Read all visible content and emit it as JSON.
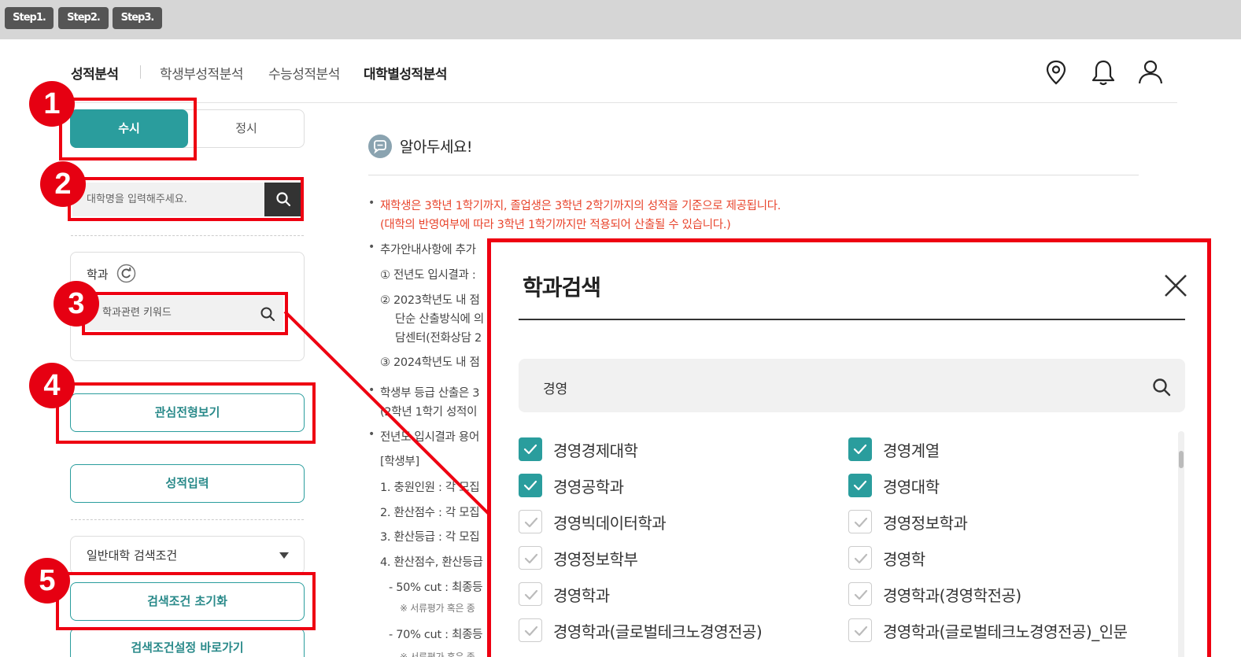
{
  "steps": [
    "Step1.",
    "Step2.",
    "Step3."
  ],
  "nav": {
    "brand": "성적분석",
    "items": [
      "학생부성적분석",
      "수능성적분석",
      "대학별성적분석"
    ],
    "active": "대학별성적분석",
    "icons": [
      "location-icon",
      "bell-icon",
      "user-icon"
    ]
  },
  "left": {
    "tabs": [
      "수시",
      "정시"
    ],
    "selected_tab": "수시",
    "univ_search_placeholder": "대학명을 입력해주세요.",
    "dept_label": "학과",
    "dept_search_placeholder": "학과관련 키워드",
    "interest_button": "관심전형보기",
    "score_button": "성적입력",
    "condition_select": "일반대학 검색조건",
    "reset_button": "검색조건 초기화",
    "goto_button": "검색조건설정 바로가기"
  },
  "annotations": [
    "1",
    "2",
    "3",
    "4",
    "5"
  ],
  "notice": {
    "title": "알아두세요!",
    "red_line1": "재학생은 3학년 1학기까지, 졸업생은 3학년 2학기까지의 성적을 기준으로 제공됩니다.",
    "red_line2": "(대학의 반영여부에 따라 3학년 1학기까지만 적용되어 산출될 수 있습니다.)",
    "lines": [
      "추가안내사항에 추가",
      "① 전년도 입시결과 :",
      "② 2023학년도 내 점",
      "단순 산출방식에 의",
      "담센터(전화상담 2",
      "③ 2024학년도 내 점",
      "학생부 등급 산출은 3",
      "(2학년 1학기 성적이",
      "전년도 입시결과 용어",
      "[학생부]",
      "1. 충원인원 : 각 모집",
      "2. 환산점수 : 각 모집",
      "3. 환산등급 : 각 모집",
      "4. 환산점수, 환산등급",
      "- 50% cut : 최종등",
      "※ 서류평가 혹은 종",
      "- 70% cut : 최종등",
      "※ 서류평가 혹은 종"
    ]
  },
  "modal": {
    "title": "학과검색",
    "search_value": "경영",
    "options": [
      {
        "label": "경영경제대학",
        "checked": true
      },
      {
        "label": "경영계열",
        "checked": true
      },
      {
        "label": "경영공학과",
        "checked": true
      },
      {
        "label": "경영대학",
        "checked": true
      },
      {
        "label": "경영빅데이터학과",
        "checked": false
      },
      {
        "label": "경영정보학과",
        "checked": false
      },
      {
        "label": "경영정보학부",
        "checked": false
      },
      {
        "label": "경영학",
        "checked": false
      },
      {
        "label": "경영학과",
        "checked": false
      },
      {
        "label": "경영학과(경영학전공)",
        "checked": false
      },
      {
        "label": "경영학과(글로벌테크노경영전공)",
        "checked": false
      },
      {
        "label": "경영학과(글로벌테크노경영전공)_인문",
        "checked": false
      }
    ]
  },
  "colors": {
    "accent": "#2a9d9d",
    "annotation": "#ee0011",
    "notice_red": "#e8442c"
  }
}
